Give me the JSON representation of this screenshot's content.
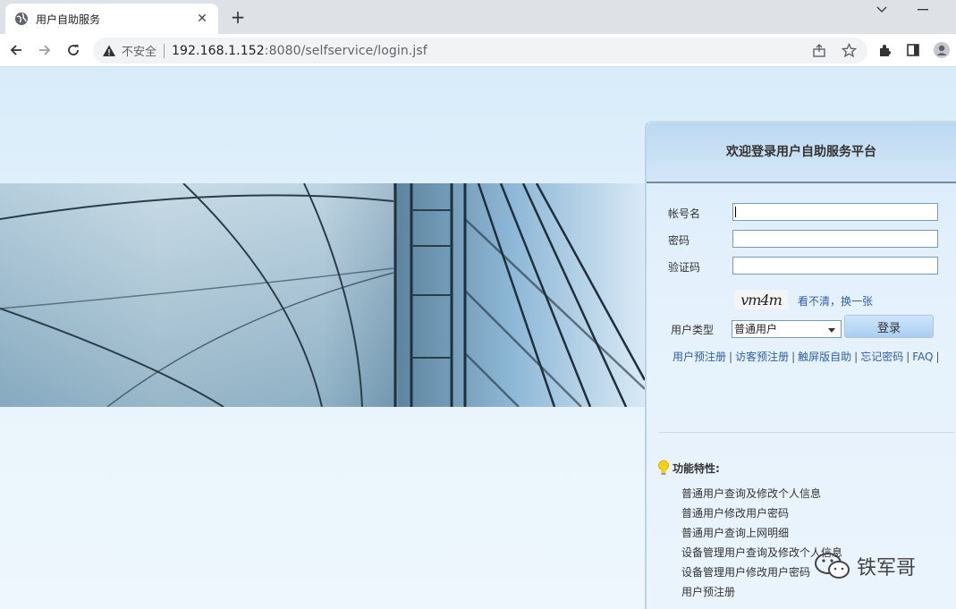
{
  "browser": {
    "tab_title": "用户自助服务",
    "insecure_label": "不安全",
    "url_host": "192.168.1.152",
    "url_rest": ":8080/selfservice/login.jsf"
  },
  "login": {
    "title": "欢迎登录用户自助服务平台",
    "username_label": "帐号名",
    "password_label": "密码",
    "captcha_label": "验证码",
    "captcha_text": "vm4m",
    "refresh_link": "看不清，换一张",
    "user_type_label": "用户类型",
    "user_type_value": "普通用户",
    "login_button": "登录",
    "links": [
      "用户预注册",
      "访客预注册",
      "触屏版自助",
      "忘记密码",
      "FAQ"
    ]
  },
  "features": {
    "title": "功能特性:",
    "items": [
      "普通用户查询及修改个人信息",
      "普通用户修改用户密码",
      "普通用户查询上网明细",
      "设备管理用户查询及修改个人信息",
      "设备管理用户修改用户密码",
      "用户预注册"
    ]
  },
  "watermark": "铁军哥"
}
